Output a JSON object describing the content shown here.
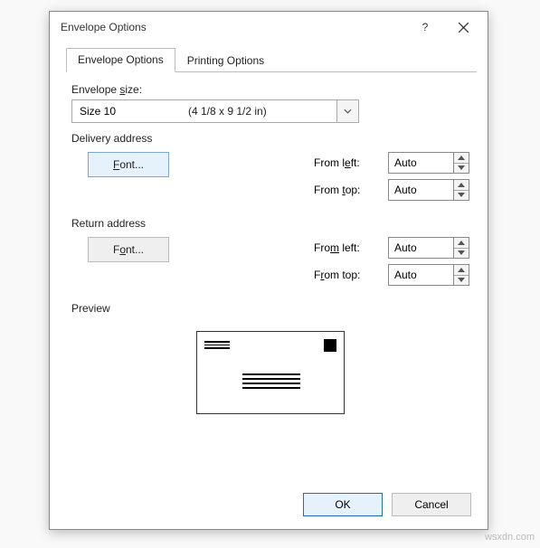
{
  "dialog": {
    "title": "Envelope Options",
    "help_label": "?",
    "tabs": {
      "envelope_options": "Envelope Options",
      "printing_options": "Printing Options"
    },
    "size_label": "Envelope size:",
    "size_name": "Size 10",
    "size_dim": "(4 1/8 x 9 1/2 in)",
    "delivery_title": "Delivery address",
    "return_title": "Return address",
    "font_prefix": "F",
    "font_rest": "ont...",
    "from_left_prefix": "From l",
    "from_left_u": "e",
    "from_left_rest": "ft:",
    "from_top_prefix": "From ",
    "from_top_u": "t",
    "from_top_rest": "op:",
    "ret_from_left_prefix": "Fro",
    "ret_from_left_u": "m",
    "ret_from_left_rest": " left:",
    "ret_from_top_prefix": "F",
    "ret_from_top_u": "r",
    "ret_from_top_rest": "om top:",
    "delivery": {
      "from_left": "Auto",
      "from_top": "Auto"
    },
    "return_addr": {
      "from_left": "Auto",
      "from_top": "Auto"
    },
    "preview_label": "Preview",
    "ok_label": "OK",
    "cancel_label": "Cancel"
  },
  "watermark": "wsxdn.com"
}
